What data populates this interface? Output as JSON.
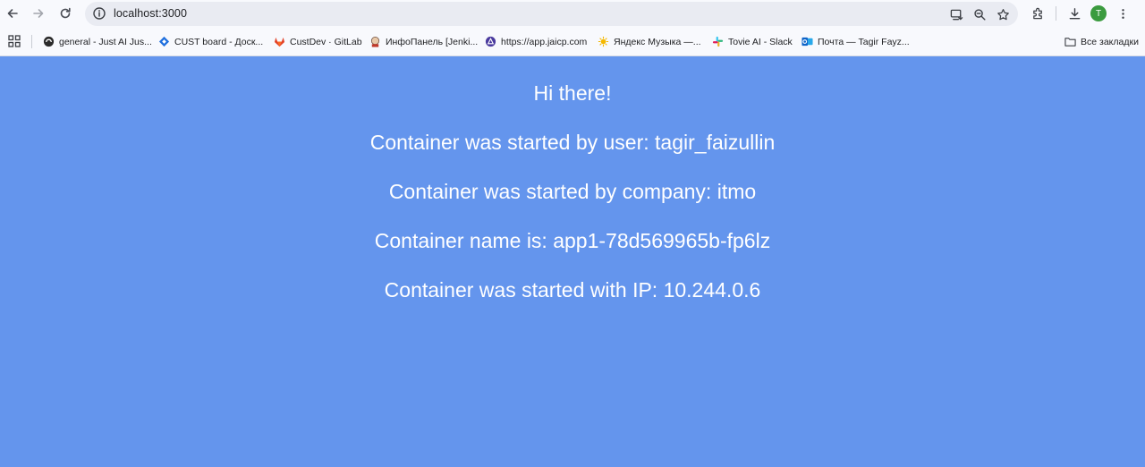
{
  "browser": {
    "url": "localhost:3000",
    "avatar_letter": "T",
    "all_bookmarks_label": "Все закладки",
    "bookmarks": [
      {
        "label": "general - Just AI Jus...",
        "icon": "slack-like-icon"
      },
      {
        "label": "CUST board - Доск...",
        "icon": "jira-icon"
      },
      {
        "label": "CustDev · GitLab",
        "icon": "gitlab-icon"
      },
      {
        "label": "ИнфоПанель [Jenki...",
        "icon": "jenkins-icon"
      },
      {
        "label": "https://app.jaicp.com",
        "icon": "jaicp-icon"
      },
      {
        "label": "Яндекс Музыка —...",
        "icon": "yandex-music-icon"
      },
      {
        "label": "Tovie AI - Slack",
        "icon": "slack-icon"
      },
      {
        "label": "Почта — Tagir Fayz...",
        "icon": "outlook-icon"
      }
    ]
  },
  "page": {
    "background": "#6495ed",
    "greeting": "Hi there!",
    "user_line": "Container was started by user: tagir_faizullin",
    "company_line": "Container was started by company: itmo",
    "name_line": "Container name is: app1-78d569965b-fp6lz",
    "ip_line": "Container was started with IP: 10.244.0.6"
  }
}
